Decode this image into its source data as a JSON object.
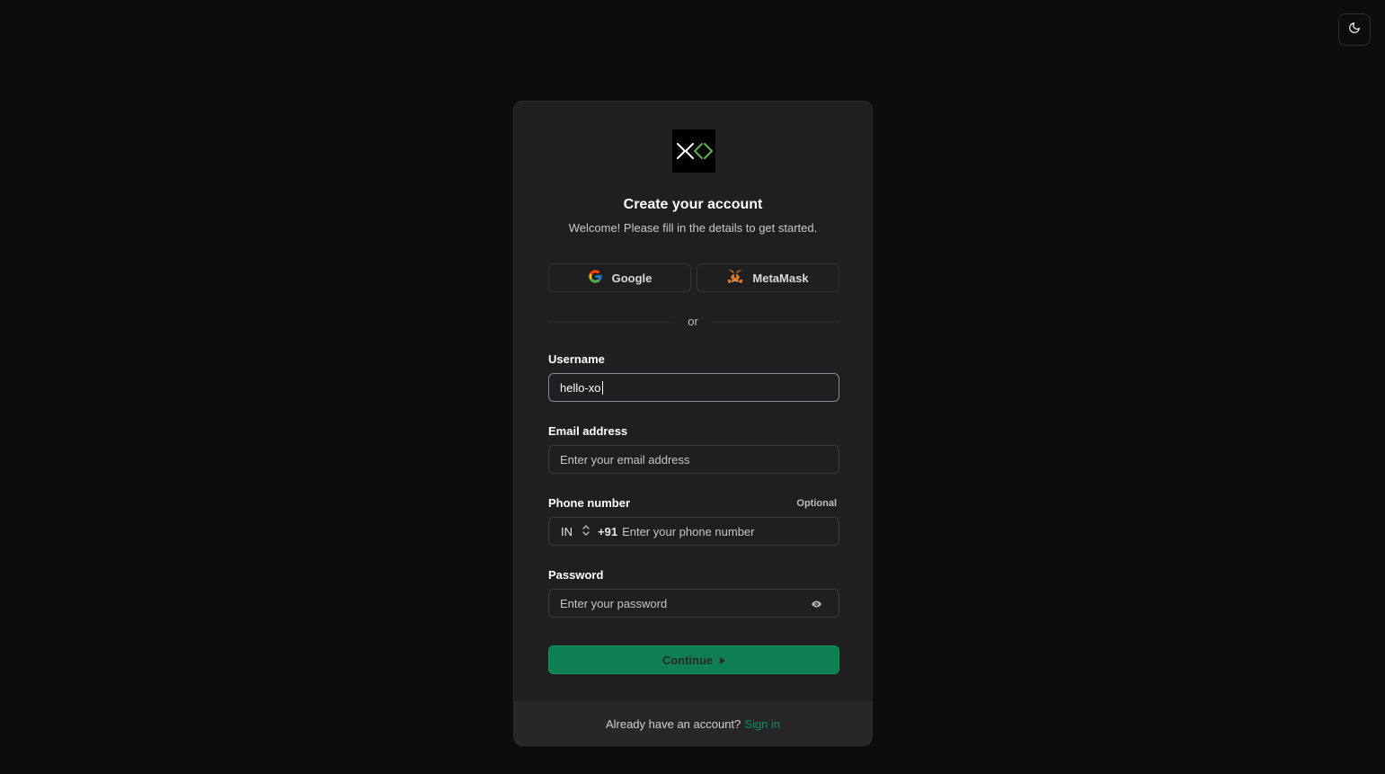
{
  "theme_toggle": {
    "icon": "moon-icon"
  },
  "card": {
    "logo": {
      "icon": "brackets-logo-icon"
    },
    "title": "Create your account",
    "subtitle": "Welcome! Please fill in the details to get started.",
    "social": {
      "google_label": "Google",
      "metamask_label": "MetaMask"
    },
    "divider_text": "or",
    "username": {
      "label": "Username",
      "value": "hello-xo"
    },
    "email": {
      "label": "Email address",
      "placeholder": "Enter your email address"
    },
    "phone": {
      "label": "Phone number",
      "optional": "Optional",
      "country": "IN",
      "code": "+91",
      "placeholder": "Enter your phone number"
    },
    "password": {
      "label": "Password",
      "placeholder": "Enter your password"
    },
    "continue_label": "Continue",
    "footer": {
      "text": "Already have an account?",
      "link": "Sign in"
    }
  },
  "colors": {
    "accent": "#0e7f52",
    "link": "#0e8f5b",
    "background": "#0d0d0d",
    "card": "#1f1f21"
  }
}
